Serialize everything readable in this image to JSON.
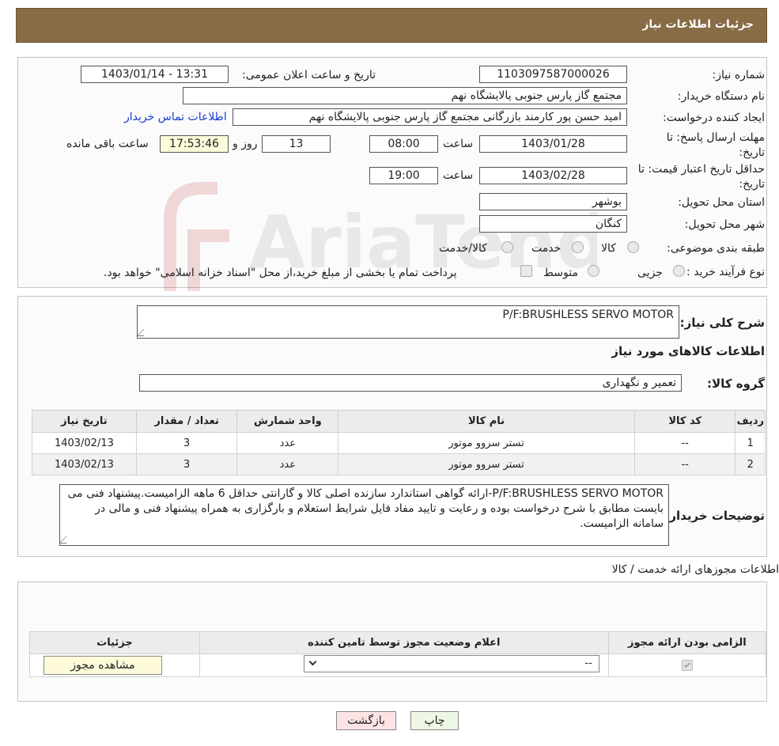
{
  "header": {
    "title": "جزئیات اطلاعات نیاز"
  },
  "form": {
    "need_number_label": "شماره نیاز:",
    "need_number": "1103097587000026",
    "announce_label": "تاریخ و ساعت اعلان عمومی:",
    "announce_value": "1403/01/14 - 13:31",
    "buyer_org_label": "نام دستگاه خریدار:",
    "buyer_org": "مجتمع گاز پارس جنوبی  پالایشگاه نهم",
    "creator_label": "ایجاد کننده درخواست:",
    "creator": "امید حسن پور کارمند بازرگانی مجتمع گاز پارس جنوبی  پالایشگاه نهم",
    "contact_link": "اطلاعات تماس خریدار",
    "reply_deadline_label": "مهلت ارسال پاسخ: تا تاریخ:",
    "reply_date": "1403/01/28",
    "time_label": "ساعت",
    "reply_time": "08:00",
    "days": "13",
    "days_label": "روز و",
    "remaining_time": "17:53:46",
    "remaining_label": "ساعت باقی مانده",
    "price_validity_label": "حداقل تاریخ اعتبار قیمت: تا تاریخ:",
    "price_date": "1403/02/28",
    "price_time": "19:00",
    "province_label": "استان محل تحویل:",
    "province": "بوشهر",
    "city_label": "شهر محل تحویل:",
    "city": "کنگان",
    "category_label": "طبقه بندی موضوعی:",
    "category_options": [
      "کالا",
      "خدمت",
      "کالا/خدمت"
    ],
    "purchase_type_label": "نوع فرآیند خرید :",
    "purchase_options": [
      "جزیی",
      "متوسط"
    ],
    "purchase_note": "پرداخت تمام یا بخشی از مبلغ خرید،از محل \"اسناد خزانه اسلامی\" خواهد بود."
  },
  "details": {
    "summary_label": "شرح کلی نیاز:",
    "summary": "P/F:BRUSHLESS SERVO MOTOR",
    "goods_info_title": "اطلاعات کالاهای مورد نیاز",
    "goods_group_label": "گروه کالا:",
    "goods_group": "تعمیر و نگهداری",
    "table": {
      "headers": [
        "ردیف",
        "کد کالا",
        "نام کالا",
        "واحد شمارش",
        "تعداد / مقدار",
        "تاریخ نیاز"
      ],
      "rows": [
        [
          "1",
          "--",
          "تستر سروو موتور",
          "عدد",
          "3",
          "1403/02/13"
        ],
        [
          "2",
          "--",
          "تستر سروو موتور",
          "عدد",
          "3",
          "1403/02/13"
        ]
      ]
    },
    "buyer_notes_label": "توضیحات خریدار:",
    "buyer_notes": "P/F:BRUSHLESS SERVO MOTOR-ارائه گواهی استاندارد سازنده اصلی کالا و گارانتی حداقل 6 ماهه الزامیست.پیشنهاد فنی می بایست مطابق با شرح درخواست بوده و رعایت و تایید مفاد فایل شرایط استعلام و بارگزاری به همراه پیشنهاد فنی و مالی در سامانه الزامیست."
  },
  "permits": {
    "title": "اطلاعات مجوزهای ارائه خدمت / کالا",
    "headers": [
      "الزامی بودن ارائه مجوز",
      "اعلام وضعیت مجوز توسط تامین کننده",
      "جزئیات"
    ],
    "select_value": "--",
    "view_button": "مشاهده مجوز"
  },
  "actions": {
    "print": "چاپ",
    "back": "بازگشت"
  },
  "watermark": {
    "text": "AriaTender.neT"
  }
}
